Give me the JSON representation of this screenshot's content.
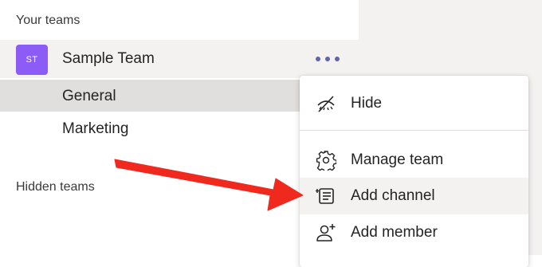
{
  "sidebar": {
    "your_teams_label": "Your teams",
    "team": {
      "avatar_initials": "ST",
      "avatar_color": "#8b5cf6",
      "name": "Sample Team"
    },
    "channels": [
      {
        "label": "General",
        "selected": true
      },
      {
        "label": "Marketing",
        "selected": false
      }
    ],
    "hidden_teams_label": "Hidden teams"
  },
  "context_menu": {
    "items": [
      {
        "label": "Hide",
        "icon": "eye-slash-icon"
      },
      {
        "label": "Manage team",
        "icon": "gear-icon"
      },
      {
        "label": "Add channel",
        "icon": "channel-list-icon"
      },
      {
        "label": "Add member",
        "icon": "add-person-icon"
      }
    ]
  },
  "colors": {
    "accent": "#6264a7",
    "annotation_arrow": "#f0291f"
  }
}
